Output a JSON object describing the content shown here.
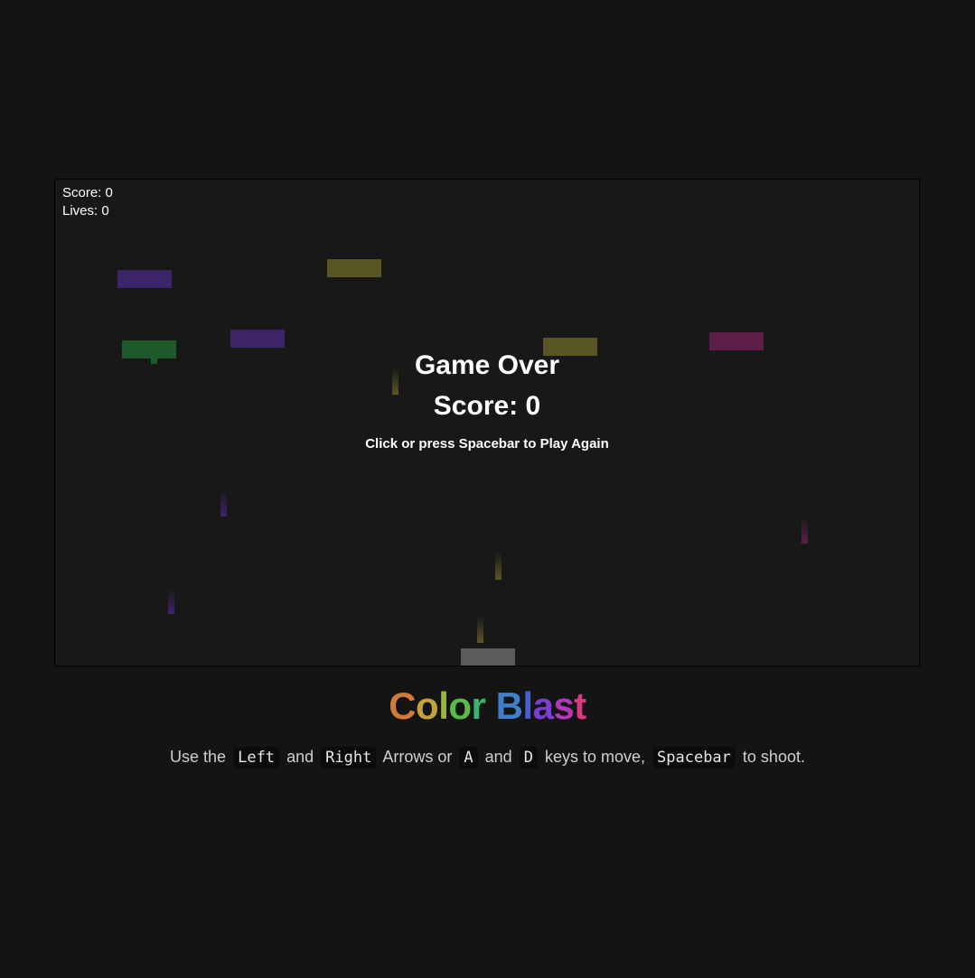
{
  "hud": {
    "score_label": "Score:",
    "score_value": "0",
    "lives_label": "Lives:",
    "lives_value": "0"
  },
  "overlay": {
    "title": "Game Over",
    "score_label": "Score:",
    "score_value": "0",
    "prompt": "Click or press Spacebar to Play Again"
  },
  "title_letters": [
    {
      "char": "C",
      "color": "#d07a3c"
    },
    {
      "char": "o",
      "color": "#c4a33a"
    },
    {
      "char": "l",
      "color": "#9bb83c"
    },
    {
      "char": "o",
      "color": "#5aba4c"
    },
    {
      "char": "r",
      "color": "#3ab46e"
    },
    {
      "char": " ",
      "color": "#ffffff"
    },
    {
      "char": "B",
      "color": "#3f7fc9"
    },
    {
      "char": "l",
      "color": "#4a5ed0"
    },
    {
      "char": "a",
      "color": "#7a3fd0"
    },
    {
      "char": "s",
      "color": "#b03ab8"
    },
    {
      "char": "t",
      "color": "#d83a7e"
    }
  ],
  "instructions": {
    "t1": "Use the",
    "k_left": "Left",
    "t2": "and",
    "k_right": "Right",
    "t3": "Arrows or",
    "k_a": "A",
    "t4": "and",
    "k_d": "D",
    "t5": "keys to move,",
    "k_space": "Spacebar",
    "t6": "to shoot."
  },
  "colors": {
    "background": "#141414",
    "game_bg": "#181818",
    "purple_brick": "#3d2468",
    "yellow_brick": "#595626",
    "green_brick": "#1f5a2a",
    "magenta_brick": "#5d1f4a",
    "player": "#5c5c5c"
  }
}
